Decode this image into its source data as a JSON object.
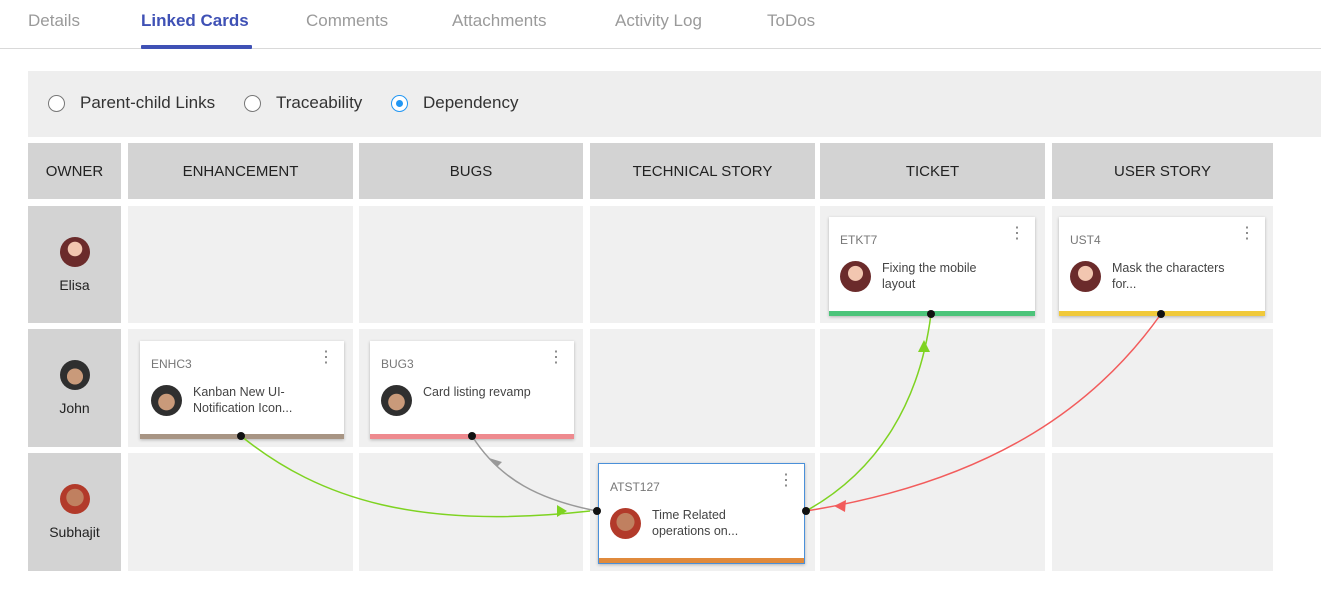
{
  "tabs": [
    {
      "label": "Details"
    },
    {
      "label": "Linked Cards"
    },
    {
      "label": "Comments"
    },
    {
      "label": "Attachments"
    },
    {
      "label": "Activity Log"
    },
    {
      "label": "ToDos"
    }
  ],
  "filters": [
    {
      "label": "Parent-child Links",
      "checked": false
    },
    {
      "label": "Traceability",
      "checked": false
    },
    {
      "label": "Dependency",
      "checked": true
    }
  ],
  "board": {
    "owner_header": "OWNER",
    "columns": [
      "ENHANCEMENT",
      "BUGS",
      "TECHNICAL STORY",
      "TICKET",
      "USER STORY"
    ],
    "owners": [
      {
        "name": "Elisa"
      },
      {
        "name": "John"
      },
      {
        "name": "Subhajit"
      }
    ]
  },
  "cards": [
    {
      "id": "ETKT7",
      "text": "Fixing the mobile layout",
      "owner": "Elisa",
      "column": "TICKET",
      "bar_color": "#4cc47a"
    },
    {
      "id": "UST4",
      "text": "Mask the characters for...",
      "owner": "Elisa",
      "column": "USER STORY",
      "bar_color": "#f0c93a"
    },
    {
      "id": "ENHC3",
      "text": "Kanban New UI- Notification Icon...",
      "owner": "John",
      "column": "ENHANCEMENT",
      "bar_color": "#a89584"
    },
    {
      "id": "BUG3",
      "text": "Card listing revamp",
      "owner": "John",
      "column": "BUGS",
      "bar_color": "#ee8a8f"
    },
    {
      "id": "ATST127",
      "text": "Time Related operations on...",
      "owner": "Subhajit",
      "column": "TECHNICAL STORY",
      "bar_color": "#e08a3c",
      "selected": true
    }
  ],
  "menu_icon": "⋮",
  "links_colors": {
    "green": "#7ed321",
    "red": "#f25c5c",
    "grey": "#999999"
  }
}
